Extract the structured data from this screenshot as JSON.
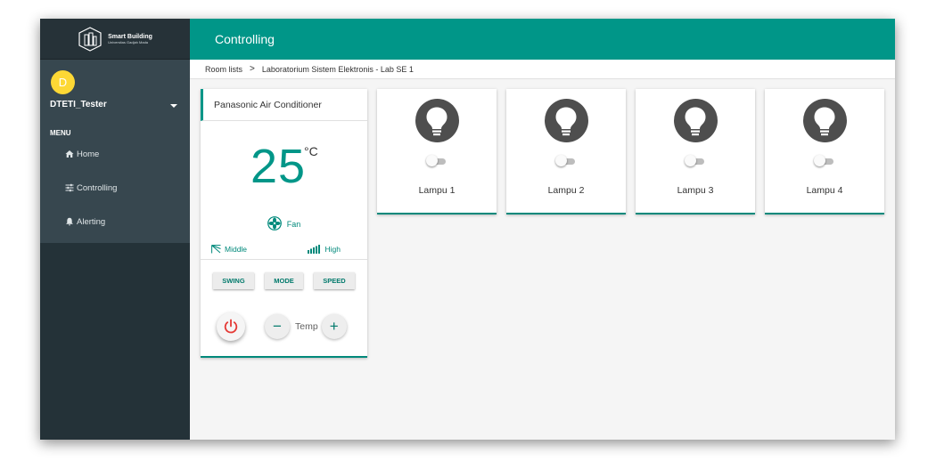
{
  "colors": {
    "primary": "#009688",
    "sidebar": "#37474f",
    "sidebar_dark": "#243238",
    "avatar": "#fdd835",
    "power": "#e53935"
  },
  "brand": {
    "title": "Smart Building",
    "subtitle": "Universitas Gadjah Mada"
  },
  "user": {
    "initial": "D",
    "name": "DTETI_Tester"
  },
  "menu": {
    "label": "MENU",
    "items": [
      {
        "label": "Home",
        "icon": "home-icon"
      },
      {
        "label": "Controlling",
        "icon": "sliders-icon"
      },
      {
        "label": "Alerting",
        "icon": "bell-icon"
      }
    ]
  },
  "header": {
    "title": "Controlling"
  },
  "breadcrumb": {
    "root": "Room lists",
    "separator": ">",
    "current": "Laboratorium Sistem Elektronis - Lab SE 1"
  },
  "ac": {
    "name": "Panasonic Air Conditioner",
    "temperature": "25",
    "unit": "°C",
    "fan_label": "Fan",
    "swing_label": "Middle",
    "speed_label": "High",
    "buttons": {
      "swing": "SWING",
      "mode": "MODE",
      "speed": "SPEED"
    },
    "temp_label": "Temp",
    "minus": "−",
    "plus": "+"
  },
  "lamps": [
    {
      "name": "Lampu 1",
      "on": false
    },
    {
      "name": "Lampu 2",
      "on": false
    },
    {
      "name": "Lampu 3",
      "on": false
    },
    {
      "name": "Lampu 4",
      "on": false
    }
  ]
}
